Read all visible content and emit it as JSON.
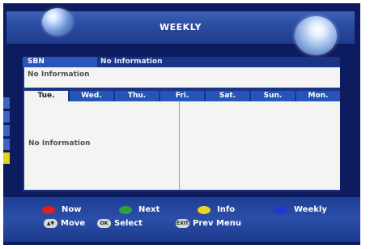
{
  "header": {
    "title": "WEEKLY"
  },
  "service": {
    "name": "SBN",
    "info": "No Information"
  },
  "epg": {
    "detail": "No Information",
    "schedule": "No Information"
  },
  "days": [
    {
      "label": "Tue.",
      "active": true
    },
    {
      "label": "Wed.",
      "active": false
    },
    {
      "label": "Thu.",
      "active": false
    },
    {
      "label": "Fri.",
      "active": false
    },
    {
      "label": "Sat.",
      "active": false
    },
    {
      "label": "Sun.",
      "active": false
    },
    {
      "label": "Mon.",
      "active": false
    }
  ],
  "legend": {
    "now": "Now",
    "next": "Next",
    "info": "Info",
    "weekly": "Weekly",
    "move": "Move",
    "select": "Select",
    "prev_menu": "Prev Menu",
    "ok_icon": "OK",
    "exit_icon": "EXIT"
  },
  "colors": {
    "red": "#e0201a",
    "green": "#2aa13a",
    "yellow": "#f0d520",
    "blue": "#2038d0"
  }
}
